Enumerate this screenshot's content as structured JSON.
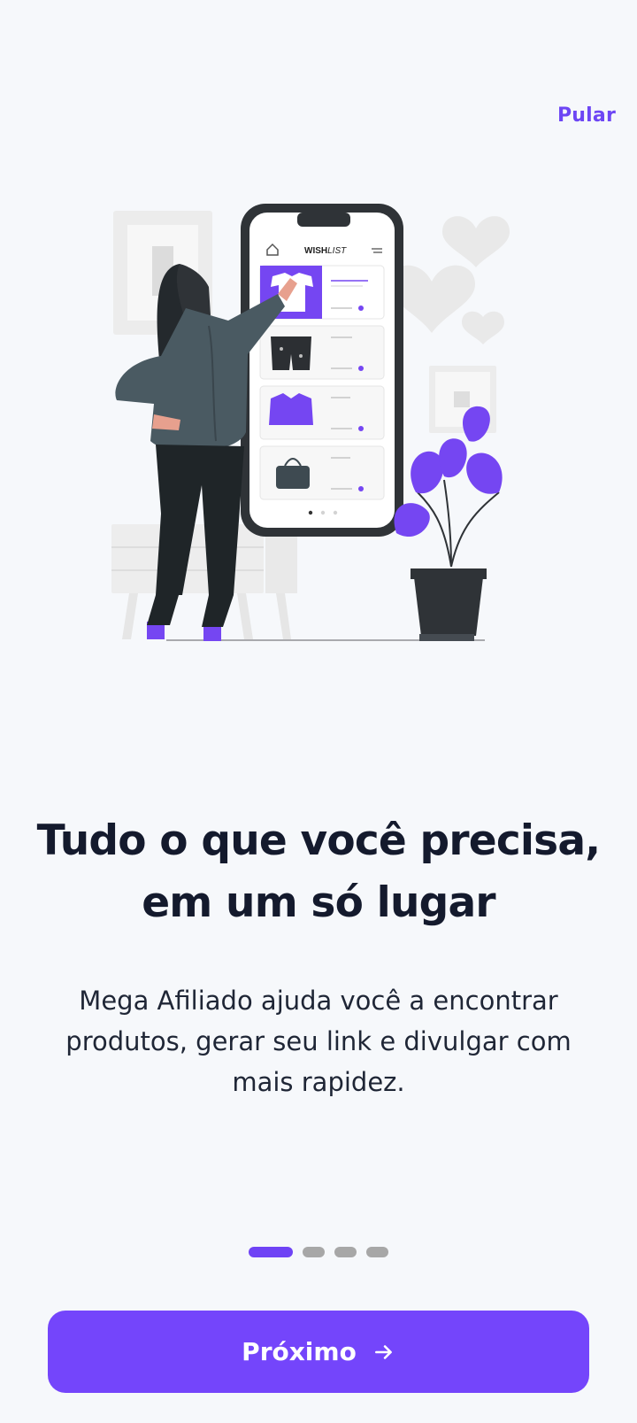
{
  "header": {
    "skip_label": "Pular"
  },
  "illustration": {
    "brand_prefix": "WISH",
    "brand_suffix": "LIST"
  },
  "onboarding": {
    "title": "Tudo o que você precisa, em um só lugar",
    "description": "Mega Afiliado ajuda você a encontrar produtos, gerar seu link e divulgar com mais rapidez.",
    "current_step": 1,
    "total_steps": 4
  },
  "footer": {
    "next_label": "Próximo"
  },
  "theme": {
    "accent": "#7445fb",
    "background": "#f6f8fb",
    "text": "#141a2d"
  },
  "icons": {
    "next": "arrow-right-icon"
  }
}
